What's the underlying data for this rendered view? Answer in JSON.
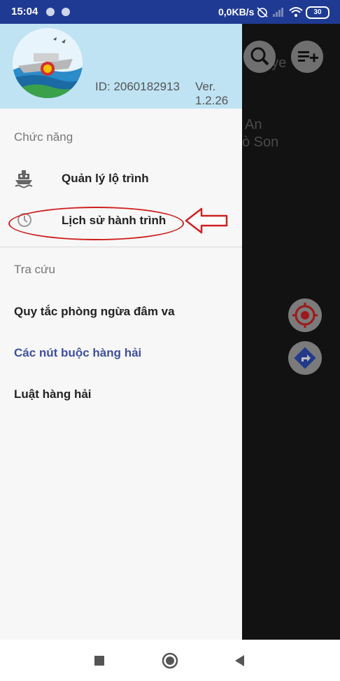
{
  "status_bar": {
    "time": "15:04",
    "network_speed": "0,0KB/s",
    "battery": "30",
    "icons": [
      "notification-dot",
      "notification-dot",
      "alarm-off-icon",
      "signal-icon",
      "wifi-icon",
      "battery-icon"
    ]
  },
  "drawer": {
    "header": {
      "app_id": "ID: 2060182913",
      "version_line1": "Ver.",
      "version_line2": "1.2.26"
    },
    "sections": {
      "functions_title": "Chức năng",
      "lookup_title": "Tra cứu"
    },
    "menu": [
      {
        "label": "Quản lý lộ trình",
        "icon": "ship-icon"
      },
      {
        "label": "Lịch sử hành trình",
        "icon": "clock-icon"
      }
    ],
    "links": [
      {
        "label": "Quy tắc phòng ngừa đâm va"
      },
      {
        "label": "Các nút buộc hàng hải"
      },
      {
        "label": "Luật hàng hải"
      }
    ]
  },
  "map": {
    "labels": [
      "guye",
      "An",
      "ò Son"
    ]
  },
  "colors": {
    "status_bar": "#1f3a93",
    "drawer_header": "#bfe3f3",
    "active_link": "#3f4f9f",
    "annotation": "#d02020"
  }
}
